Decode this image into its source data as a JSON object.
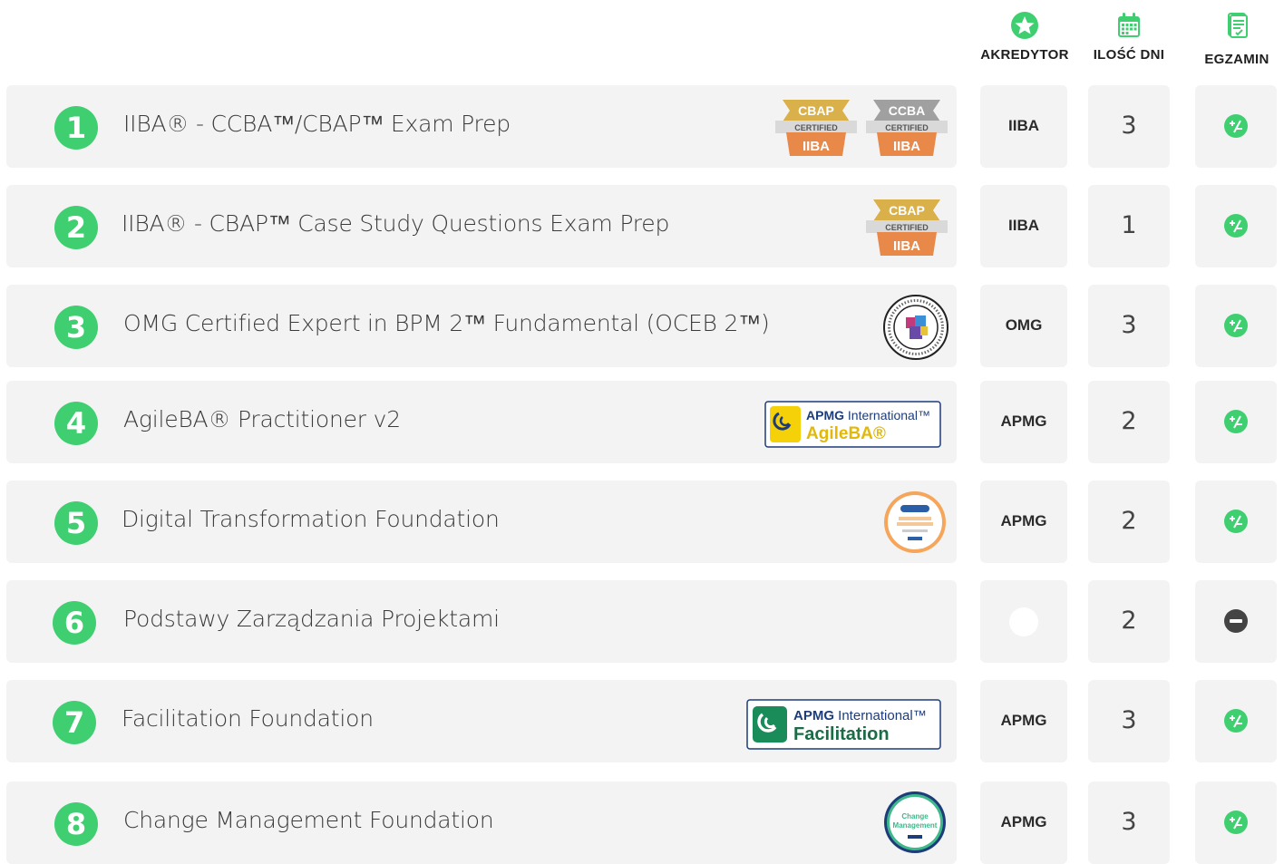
{
  "header": {
    "akredytor": "AKREDYTOR",
    "ilosc_dni": "ILOŚĆ DNI",
    "egzamin": "EGZAMIN"
  },
  "badges": {
    "cbap": "CBAP",
    "ccba": "CCBA",
    "certified": "CERTIFIED",
    "iiba": "IIBA",
    "apmg": "APMG",
    "international": "International™",
    "agileba": "AgileBA®",
    "facilitation": "Facilitation",
    "change": "Change",
    "management": "Management"
  },
  "colors": {
    "accent": "#3fcf71",
    "card": "#f3f3f3",
    "negative": "#444444"
  },
  "rows": [
    {
      "num": "1",
      "title": "IIBA® - CCBA™/CBAP™ Exam Prep",
      "akredytor": "IIBA",
      "dni": "3",
      "egzamin": "plus-minus"
    },
    {
      "num": "2",
      "title": "IIBA® - CBAP™ Case Study Questions Exam Prep",
      "akredytor": "IIBA",
      "dni": "1",
      "egzamin": "plus-minus"
    },
    {
      "num": "3",
      "title": "OMG Certified Expert in BPM 2™ Fundamental (OCEB 2™)",
      "akredytor": "OMG",
      "dni": "3",
      "egzamin": "plus-minus"
    },
    {
      "num": "4",
      "title": "AgileBA® Practitioner v2",
      "akredytor": "APMG",
      "dni": "2",
      "egzamin": "plus-minus"
    },
    {
      "num": "5",
      "title": "Digital Transformation Foundation",
      "akredytor": "APMG",
      "dni": "2",
      "egzamin": "plus-minus"
    },
    {
      "num": "6",
      "title": "Podstawy Zarządzania Projektami",
      "akredytor": "",
      "dni": "2",
      "egzamin": "minus"
    },
    {
      "num": "7",
      "title": "Facilitation Foundation",
      "akredytor": "APMG",
      "dni": "3",
      "egzamin": "plus-minus"
    },
    {
      "num": "8",
      "title": "Change Management Foundation",
      "akredytor": "APMG",
      "dni": "3",
      "egzamin": "plus-minus"
    }
  ]
}
